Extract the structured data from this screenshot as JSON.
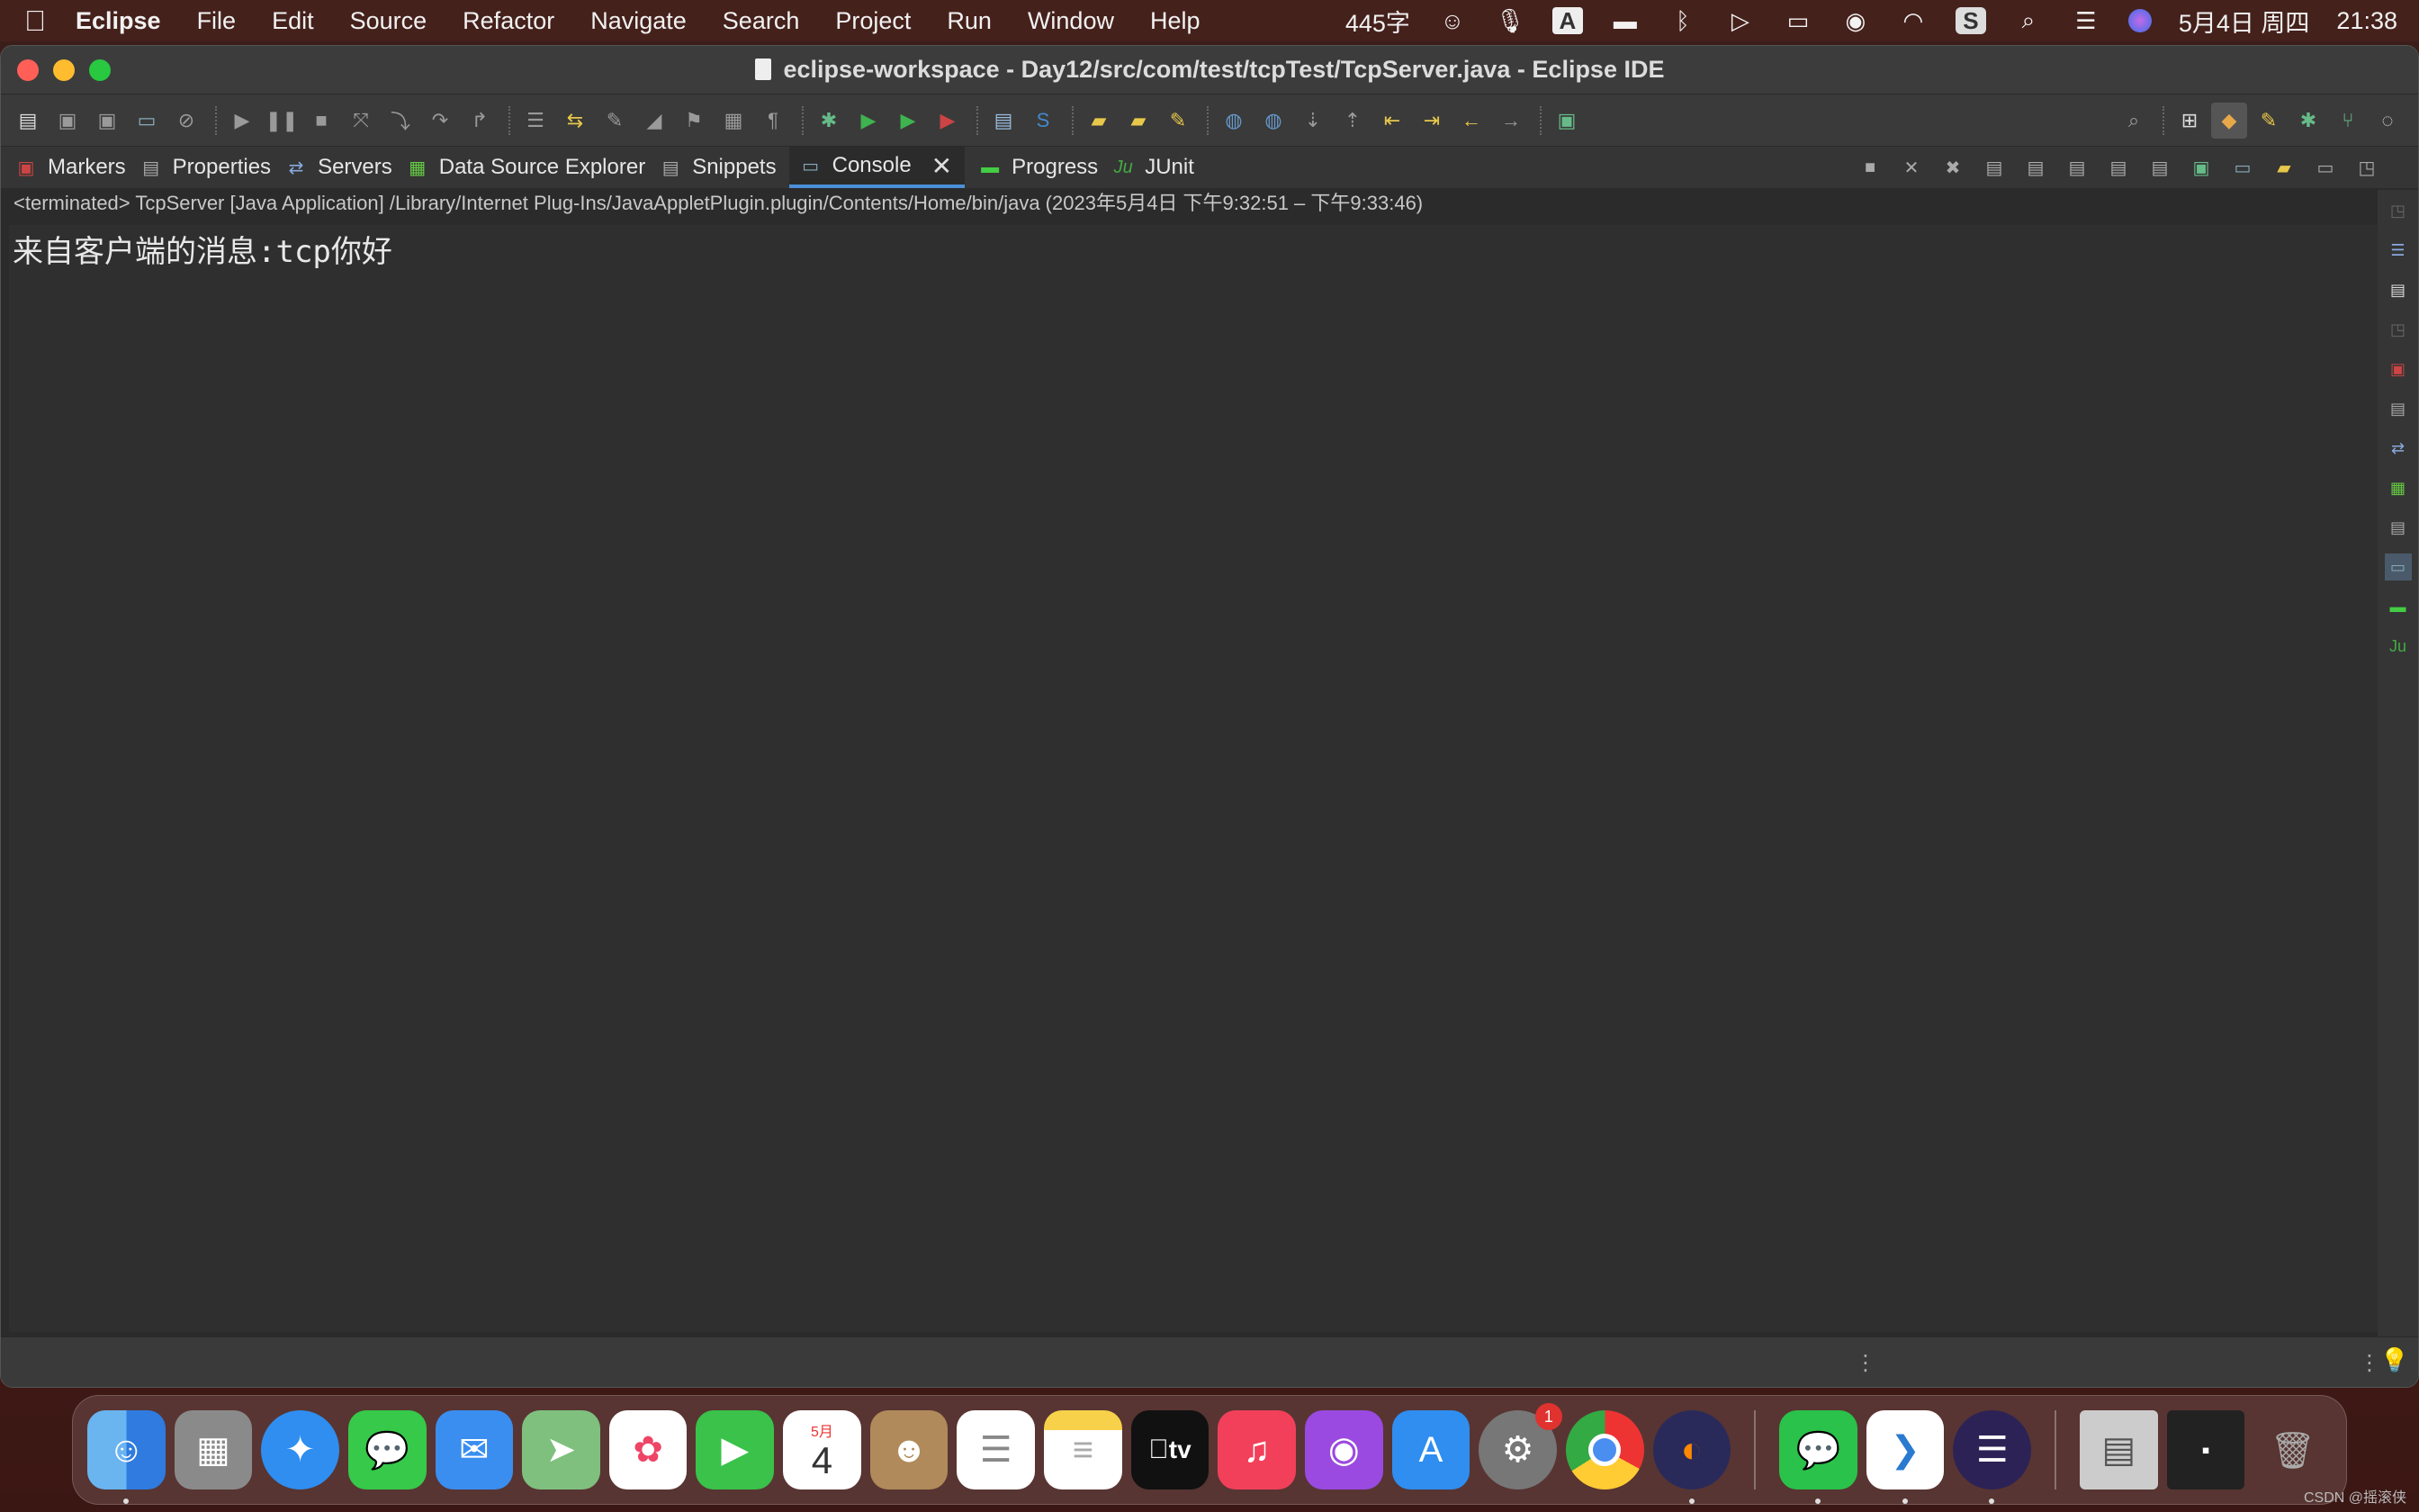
{
  "menubar": {
    "app_name": "Eclipse",
    "items": [
      "File",
      "Edit",
      "Source",
      "Refactor",
      "Navigate",
      "Search",
      "Project",
      "Run",
      "Window",
      "Help"
    ],
    "input_counter": "445字",
    "date": "5月4日 周四",
    "time": "21:38"
  },
  "window": {
    "title": "eclipse-workspace - Day12/src/com/test/tcpTest/TcpServer.java - Eclipse IDE"
  },
  "view_tabs": [
    {
      "label": "Markers",
      "icon": "markers-icon"
    },
    {
      "label": "Properties",
      "icon": "properties-icon"
    },
    {
      "label": "Servers",
      "icon": "servers-icon"
    },
    {
      "label": "Data Source Explorer",
      "icon": "data-source-explorer-icon"
    },
    {
      "label": "Snippets",
      "icon": "snippets-icon"
    },
    {
      "label": "Console",
      "icon": "console-icon",
      "active": true
    },
    {
      "label": "Progress",
      "icon": "progress-icon"
    },
    {
      "label": "JUnit",
      "icon": "junit-icon"
    }
  ],
  "console": {
    "process_line": "<terminated> TcpServer [Java Application] /Library/Internet Plug-Ins/JavaAppletPlugin.plugin/Contents/Home/bin/java  (2023年5月4日 下午9:32:51 – 下午9:33:46)",
    "output": "来自客户端的消息:tcp你好"
  },
  "dock": {
    "apps": [
      "Finder",
      "Launchpad",
      "Safari",
      "Messages",
      "Mail",
      "Maps",
      "Photos",
      "FaceTime",
      "Calendar",
      "Contacts",
      "Reminders",
      "Notes",
      "TV",
      "Music",
      "Podcasts",
      "App Store",
      "System Preferences",
      "Chrome",
      "Firefox",
      "WeChat",
      "VS Code",
      "Eclipse"
    ],
    "calendar_month": "5月",
    "calendar_day": "4",
    "tv_label": "tv",
    "system_prefs_badge": "1"
  },
  "watermark": "CSDN @摇滚侠",
  "colors": {
    "console_bg": "#2f2f2f",
    "active_tab_underline": "#4a8fd8"
  }
}
